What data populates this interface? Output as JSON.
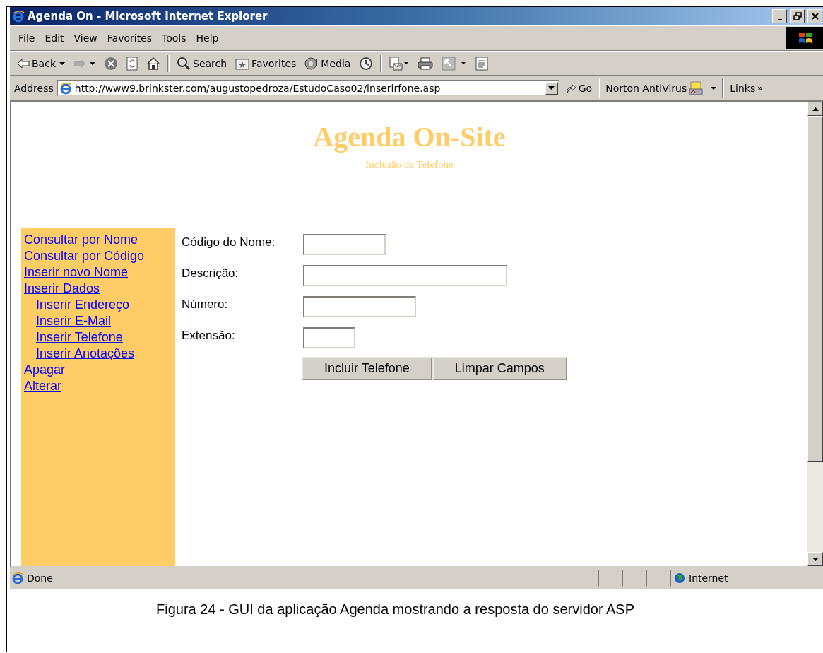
{
  "window": {
    "title": "Agenda On - Microsoft Internet Explorer"
  },
  "menu": [
    "File",
    "Edit",
    "View",
    "Favorites",
    "Tools",
    "Help"
  ],
  "toolbar": [
    {
      "kind": "back",
      "label": "Back"
    },
    {
      "kind": "forward"
    },
    {
      "kind": "stop"
    },
    {
      "kind": "refresh"
    },
    {
      "kind": "home"
    },
    {
      "kind": "search",
      "label": "Search"
    },
    {
      "kind": "favorites",
      "label": "Favorites"
    },
    {
      "kind": "media",
      "label": "Media"
    },
    {
      "kind": "history"
    },
    {
      "kind": "mail"
    },
    {
      "kind": "print"
    },
    {
      "kind": "edit"
    },
    {
      "kind": "discuss"
    }
  ],
  "address_bar": {
    "label": "Address",
    "url": "http://www9.brinkster.com/augustopedroza/EstudoCaso02/inserirfone.asp",
    "go": "Go",
    "norton": "Norton AntiVirus",
    "links": "Links",
    "chevron": "»"
  },
  "page": {
    "title": "Agenda On-Site",
    "subtitle": "Inclusão de Telefone",
    "nav": [
      {
        "label": "Consultar por Nome"
      },
      {
        "label": "Consultar por Código"
      },
      {
        "label": "Inserir novo Nome"
      },
      {
        "label": "Inserir Dados",
        "children": [
          {
            "label": "Inserir Endereço"
          },
          {
            "label": "Inserir E-Mail"
          },
          {
            "label": "Inserir Telefone"
          },
          {
            "label": "Inserir Anotações"
          }
        ]
      },
      {
        "label": "Apagar"
      },
      {
        "label": "Alterar"
      }
    ],
    "fields": [
      {
        "label": "Código do Nome:"
      },
      {
        "label": "Descrição:"
      },
      {
        "label": "Número:"
      },
      {
        "label": "Extensão:"
      }
    ],
    "buttons": [
      "Incluir Telefone",
      "Limpar Campos"
    ]
  },
  "status_bar": {
    "text": "Done",
    "zone": "Internet"
  },
  "caption": "Figura 24 - GUI da aplicação Agenda mostrando a resposta do servidor ASP"
}
